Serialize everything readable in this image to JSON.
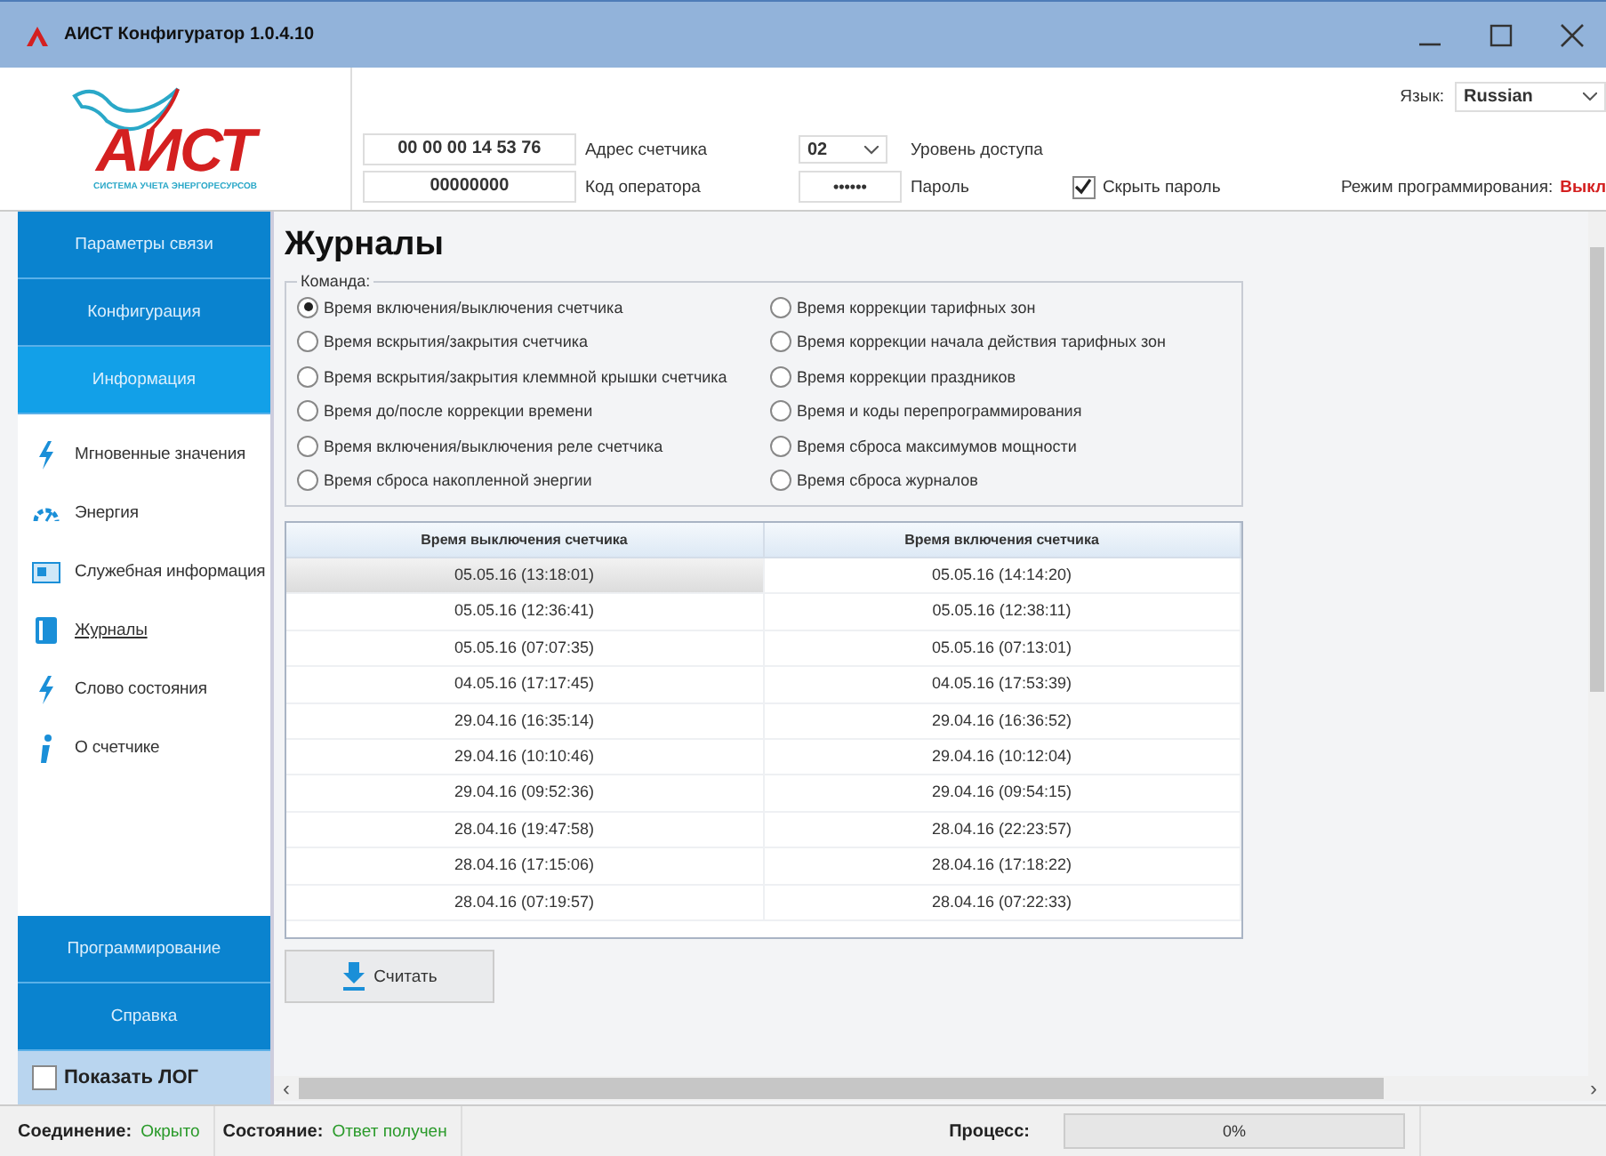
{
  "window": {
    "title": "АИСТ Конфигуратор 1.0.4.10"
  },
  "header": {
    "logo": {
      "name": "АИСТ",
      "tagline": "СИСТЕМА УЧЕТА ЭНЕРГОРЕСУРСОВ"
    },
    "address": {
      "value": "00 00 00 14 53 76",
      "label": "Адрес счетчика"
    },
    "operator": {
      "value": "00000000",
      "label": "Код оператора"
    },
    "access": {
      "value": "02",
      "label": "Уровень доступа"
    },
    "password": {
      "value": "••••••",
      "label": "Пароль"
    },
    "hide_password": {
      "label": "Скрыть пароль",
      "checked": true
    },
    "language": {
      "label": "Язык:",
      "value": "Russian"
    },
    "prog_mode": {
      "label": "Режим программирования:",
      "value": "Выкл"
    }
  },
  "sidebar": {
    "sections": [
      {
        "label": "Параметры связи",
        "selected": false
      },
      {
        "label": "Конфигурация",
        "selected": false
      },
      {
        "label": "Информация",
        "selected": true,
        "items": [
          {
            "label": "Мгновенные значения",
            "selected": false
          },
          {
            "label": "Энергия",
            "selected": false
          },
          {
            "label": "Служебная информация",
            "selected": false
          },
          {
            "label": "Журналы",
            "selected": true
          },
          {
            "label": "Слово состояния",
            "selected": false
          },
          {
            "label": "О счетчике",
            "selected": false
          }
        ]
      },
      {
        "label": "Программирование",
        "selected": false
      },
      {
        "label": "Справка",
        "selected": false
      }
    ],
    "show_log": {
      "label": "Показать ЛОГ",
      "checked": false
    }
  },
  "page": {
    "title": "Журналы",
    "command": {
      "legend": "Команда:",
      "options": [
        {
          "label": "Время включения/выключения счетчика",
          "selected": true
        },
        {
          "label": "Время вскрытия/закрытия счетчика",
          "selected": false
        },
        {
          "label": "Время вскрытия/закрытия клеммной крышки счетчика",
          "selected": false
        },
        {
          "label": "Время до/после коррекции времени",
          "selected": false
        },
        {
          "label": "Время включения/выключения реле счетчика",
          "selected": false
        },
        {
          "label": "Время сброса накопленной энергии",
          "selected": false
        },
        {
          "label": "Время коррекции тарифных зон",
          "selected": false
        },
        {
          "label": "Время коррекции начала действия тарифных зон",
          "selected": false
        },
        {
          "label": "Время коррекции праздников",
          "selected": false
        },
        {
          "label": "Время и коды перепрограммирования",
          "selected": false
        },
        {
          "label": "Время сброса максимумов мощности",
          "selected": false
        },
        {
          "label": "Время сброса журналов",
          "selected": false
        }
      ]
    },
    "table": {
      "columns": [
        "Время выключения счетчика",
        "Время включения счетчика"
      ],
      "rows": [
        {
          "cells": [
            "05.05.16 (13:18:01)",
            "05.05.16 (14:14:20)"
          ],
          "selected": true
        },
        {
          "cells": [
            "05.05.16 (12:36:41)",
            "05.05.16 (12:38:11)"
          ],
          "selected": false
        },
        {
          "cells": [
            "05.05.16 (07:07:35)",
            "05.05.16 (07:13:01)"
          ],
          "selected": false
        },
        {
          "cells": [
            "04.05.16 (17:17:45)",
            "04.05.16 (17:53:39)"
          ],
          "selected": false
        },
        {
          "cells": [
            "29.04.16 (16:35:14)",
            "29.04.16 (16:36:52)"
          ],
          "selected": false
        },
        {
          "cells": [
            "29.04.16 (10:10:46)",
            "29.04.16 (10:12:04)"
          ],
          "selected": false
        },
        {
          "cells": [
            "29.04.16 (09:52:36)",
            "29.04.16 (09:54:15)"
          ],
          "selected": false
        },
        {
          "cells": [
            "28.04.16 (19:47:58)",
            "28.04.16 (22:23:57)"
          ],
          "selected": false
        },
        {
          "cells": [
            "28.04.16 (17:15:06)",
            "28.04.16 (17:18:22)"
          ],
          "selected": false
        },
        {
          "cells": [
            "28.04.16 (07:19:57)",
            "28.04.16 (07:22:33)"
          ],
          "selected": false
        }
      ]
    },
    "read_button": "Считать",
    "scroll_left": "‹",
    "scroll_right": "›"
  },
  "status_bar": {
    "connection": {
      "label": "Соединение:",
      "value": "Окрыто"
    },
    "state": {
      "label": "Состояние:",
      "value": "Ответ получен"
    },
    "process": {
      "label": "Процесс:",
      "level": 0,
      "reading": "0%"
    }
  }
}
